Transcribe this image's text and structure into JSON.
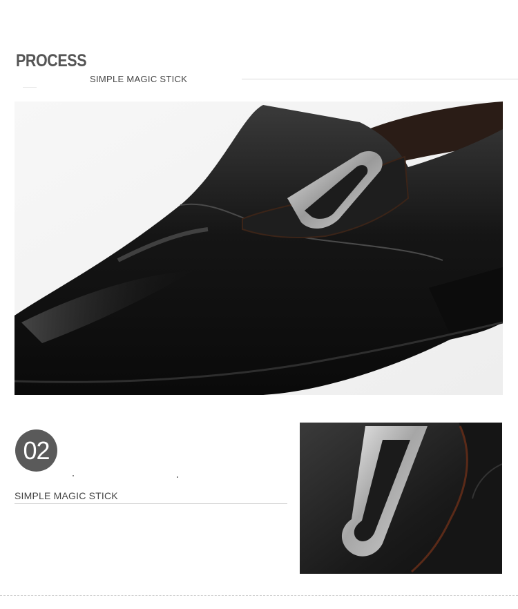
{
  "header": {
    "title": "PROCESS",
    "subtitle": "SIMPLE MAGIC STICK"
  },
  "hero_image": {
    "alt": "black leather slip-on shoe with metal buckle"
  },
  "section2": {
    "number": "02",
    "label": "SIMPLE MAGIC STICK"
  },
  "detail_image": {
    "alt": "close-up of metal D-ring buckle on black leather"
  },
  "colors": {
    "title_gray": "#555555",
    "badge": "#5a5a5a",
    "leather": "#1a1a1a",
    "metal": "#b9b9b9"
  }
}
